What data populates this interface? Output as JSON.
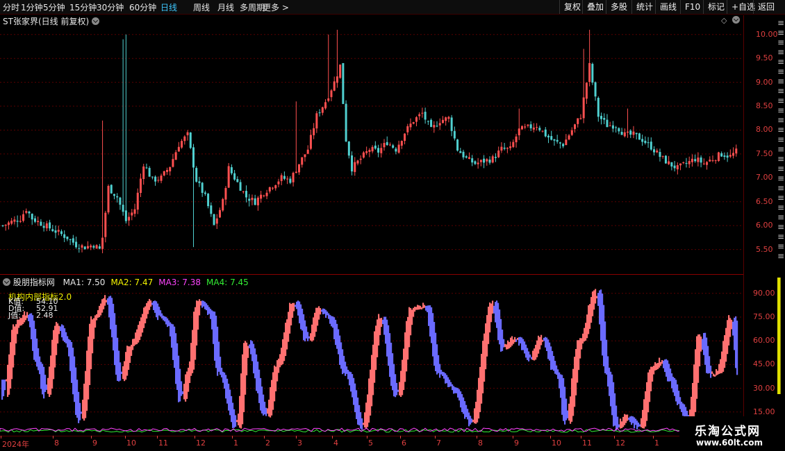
{
  "toolbar": {
    "periods": [
      "分时",
      "1分钟",
      "5分钟",
      "15分钟",
      "30分钟",
      "60分钟",
      "日线",
      "周线",
      "月线",
      "多周期",
      "更多 >"
    ],
    "active_period": "日线",
    "right_buttons": [
      "复权",
      "叠加",
      "多股",
      "统计",
      "画线",
      "F10",
      "标记",
      "+自选",
      "返回"
    ]
  },
  "main_panel": {
    "title": "ST张家界(日线 前复权)",
    "y_ticks": [
      "10.00",
      "9.50",
      "9.00",
      "8.50",
      "8.00",
      "7.50",
      "7.00",
      "6.50",
      "6.00",
      "5.50"
    ]
  },
  "indicator_panel": {
    "name": "股朋指标网",
    "ma": [
      {
        "label": "MA1: 7.50",
        "color": "#e8e8e8"
      },
      {
        "label": "MA2: 7.47",
        "color": "#f5f500"
      },
      {
        "label": "MA3: 7.38",
        "color": "#ff44ff"
      },
      {
        "label": "MA4: 7.45",
        "color": "#33ee33"
      }
    ],
    "sub_title": "机构内部指标2.0",
    "values": [
      {
        "label": "K值:",
        "value": "54.10"
      },
      {
        "label": "D值:",
        "value": "52.91"
      },
      {
        "label": "J值:",
        "value": "2.48"
      }
    ],
    "y_ticks": [
      "90.00",
      "75.00",
      "60.00",
      "45.00",
      "30.00",
      "15.00"
    ]
  },
  "x_axis": {
    "labels": [
      "2024年",
      "8",
      "9",
      "10",
      "11",
      "12",
      "1",
      "2",
      "3",
      "4",
      "5",
      "6",
      "7",
      "8",
      "9",
      "10",
      "11",
      "12",
      "1"
    ]
  },
  "watermark": {
    "line1": "乐淘公式网",
    "line2": "www.60lt.com"
  },
  "colors": {
    "up": "#ff5050",
    "down": "#50d0d0",
    "kdj_up": "#ff7070",
    "kdj_down": "#6a6aff",
    "axis": "#e04040",
    "grid": "#5a0000"
  },
  "chart_data": [
    {
      "type": "candlestick",
      "title": "ST张家界(日线 前复权)",
      "ylim": [
        5.0,
        10.2
      ],
      "close_path": [
        [
          0,
          6.0
        ],
        [
          3,
          6.08
        ],
        [
          6,
          6.15
        ],
        [
          8,
          6.35
        ],
        [
          10,
          6.15
        ],
        [
          13,
          6.05
        ],
        [
          16,
          5.95
        ],
        [
          19,
          5.85
        ],
        [
          22,
          5.75
        ],
        [
          25,
          5.6
        ],
        [
          28,
          5.55
        ],
        [
          31,
          5.6
        ],
        [
          33,
          5.5
        ],
        [
          34,
          5.75
        ],
        [
          36,
          6.8
        ],
        [
          39,
          6.6
        ],
        [
          42,
          6.1
        ],
        [
          45,
          6.35
        ],
        [
          48,
          7.3
        ],
        [
          51,
          6.95
        ],
        [
          54,
          7.0
        ],
        [
          57,
          7.25
        ],
        [
          60,
          7.7
        ],
        [
          63,
          7.9
        ],
        [
          66,
          6.95
        ],
        [
          69,
          6.6
        ],
        [
          72,
          6.0
        ],
        [
          75,
          6.5
        ],
        [
          77,
          7.2
        ],
        [
          80,
          6.9
        ],
        [
          83,
          6.6
        ],
        [
          86,
          6.5
        ],
        [
          89,
          6.7
        ],
        [
          92,
          6.85
        ],
        [
          95,
          7.0
        ],
        [
          98,
          6.95
        ],
        [
          101,
          7.3
        ],
        [
          104,
          7.6
        ],
        [
          107,
          8.3
        ],
        [
          110,
          8.6
        ],
        [
          113,
          9.0
        ],
        [
          115,
          9.35
        ],
        [
          117,
          7.8
        ],
        [
          119,
          7.2
        ],
        [
          122,
          7.4
        ],
        [
          125,
          7.6
        ],
        [
          128,
          7.55
        ],
        [
          131,
          7.75
        ],
        [
          134,
          7.6
        ],
        [
          137,
          7.95
        ],
        [
          140,
          8.2
        ],
        [
          143,
          8.35
        ],
        [
          146,
          8.0
        ],
        [
          149,
          8.2
        ],
        [
          152,
          8.25
        ],
        [
          155,
          7.6
        ],
        [
          158,
          7.4
        ],
        [
          161,
          7.3
        ],
        [
          164,
          7.35
        ],
        [
          167,
          7.4
        ],
        [
          170,
          7.6
        ],
        [
          173,
          7.6
        ],
        [
          176,
          8.0
        ],
        [
          179,
          8.05
        ],
        [
          182,
          8.1
        ],
        [
          185,
          7.9
        ],
        [
          188,
          7.75
        ],
        [
          191,
          7.7
        ],
        [
          194,
          8.0
        ],
        [
          197,
          8.3
        ],
        [
          200,
          9.35
        ],
        [
          203,
          8.3
        ],
        [
          206,
          8.1
        ],
        [
          209,
          8.1
        ],
        [
          212,
          7.9
        ],
        [
          215,
          7.9
        ],
        [
          218,
          7.8
        ],
        [
          221,
          7.65
        ],
        [
          224,
          7.45
        ],
        [
          227,
          7.3
        ],
        [
          230,
          7.2
        ],
        [
          233,
          7.3
        ],
        [
          236,
          7.4
        ],
        [
          239,
          7.3
        ],
        [
          242,
          7.4
        ],
        [
          245,
          7.5
        ],
        [
          248,
          7.45
        ],
        [
          250,
          7.55
        ]
      ]
    },
    {
      "type": "line",
      "title": "机构内部指标2.0",
      "ylim": [
        0,
        100
      ],
      "series": [
        {
          "name": "K值",
          "pattern": "oscillating",
          "last": 54.1
        },
        {
          "name": "D值",
          "last": 52.91
        },
        {
          "name": "J值",
          "last": 2.48
        }
      ]
    }
  ]
}
